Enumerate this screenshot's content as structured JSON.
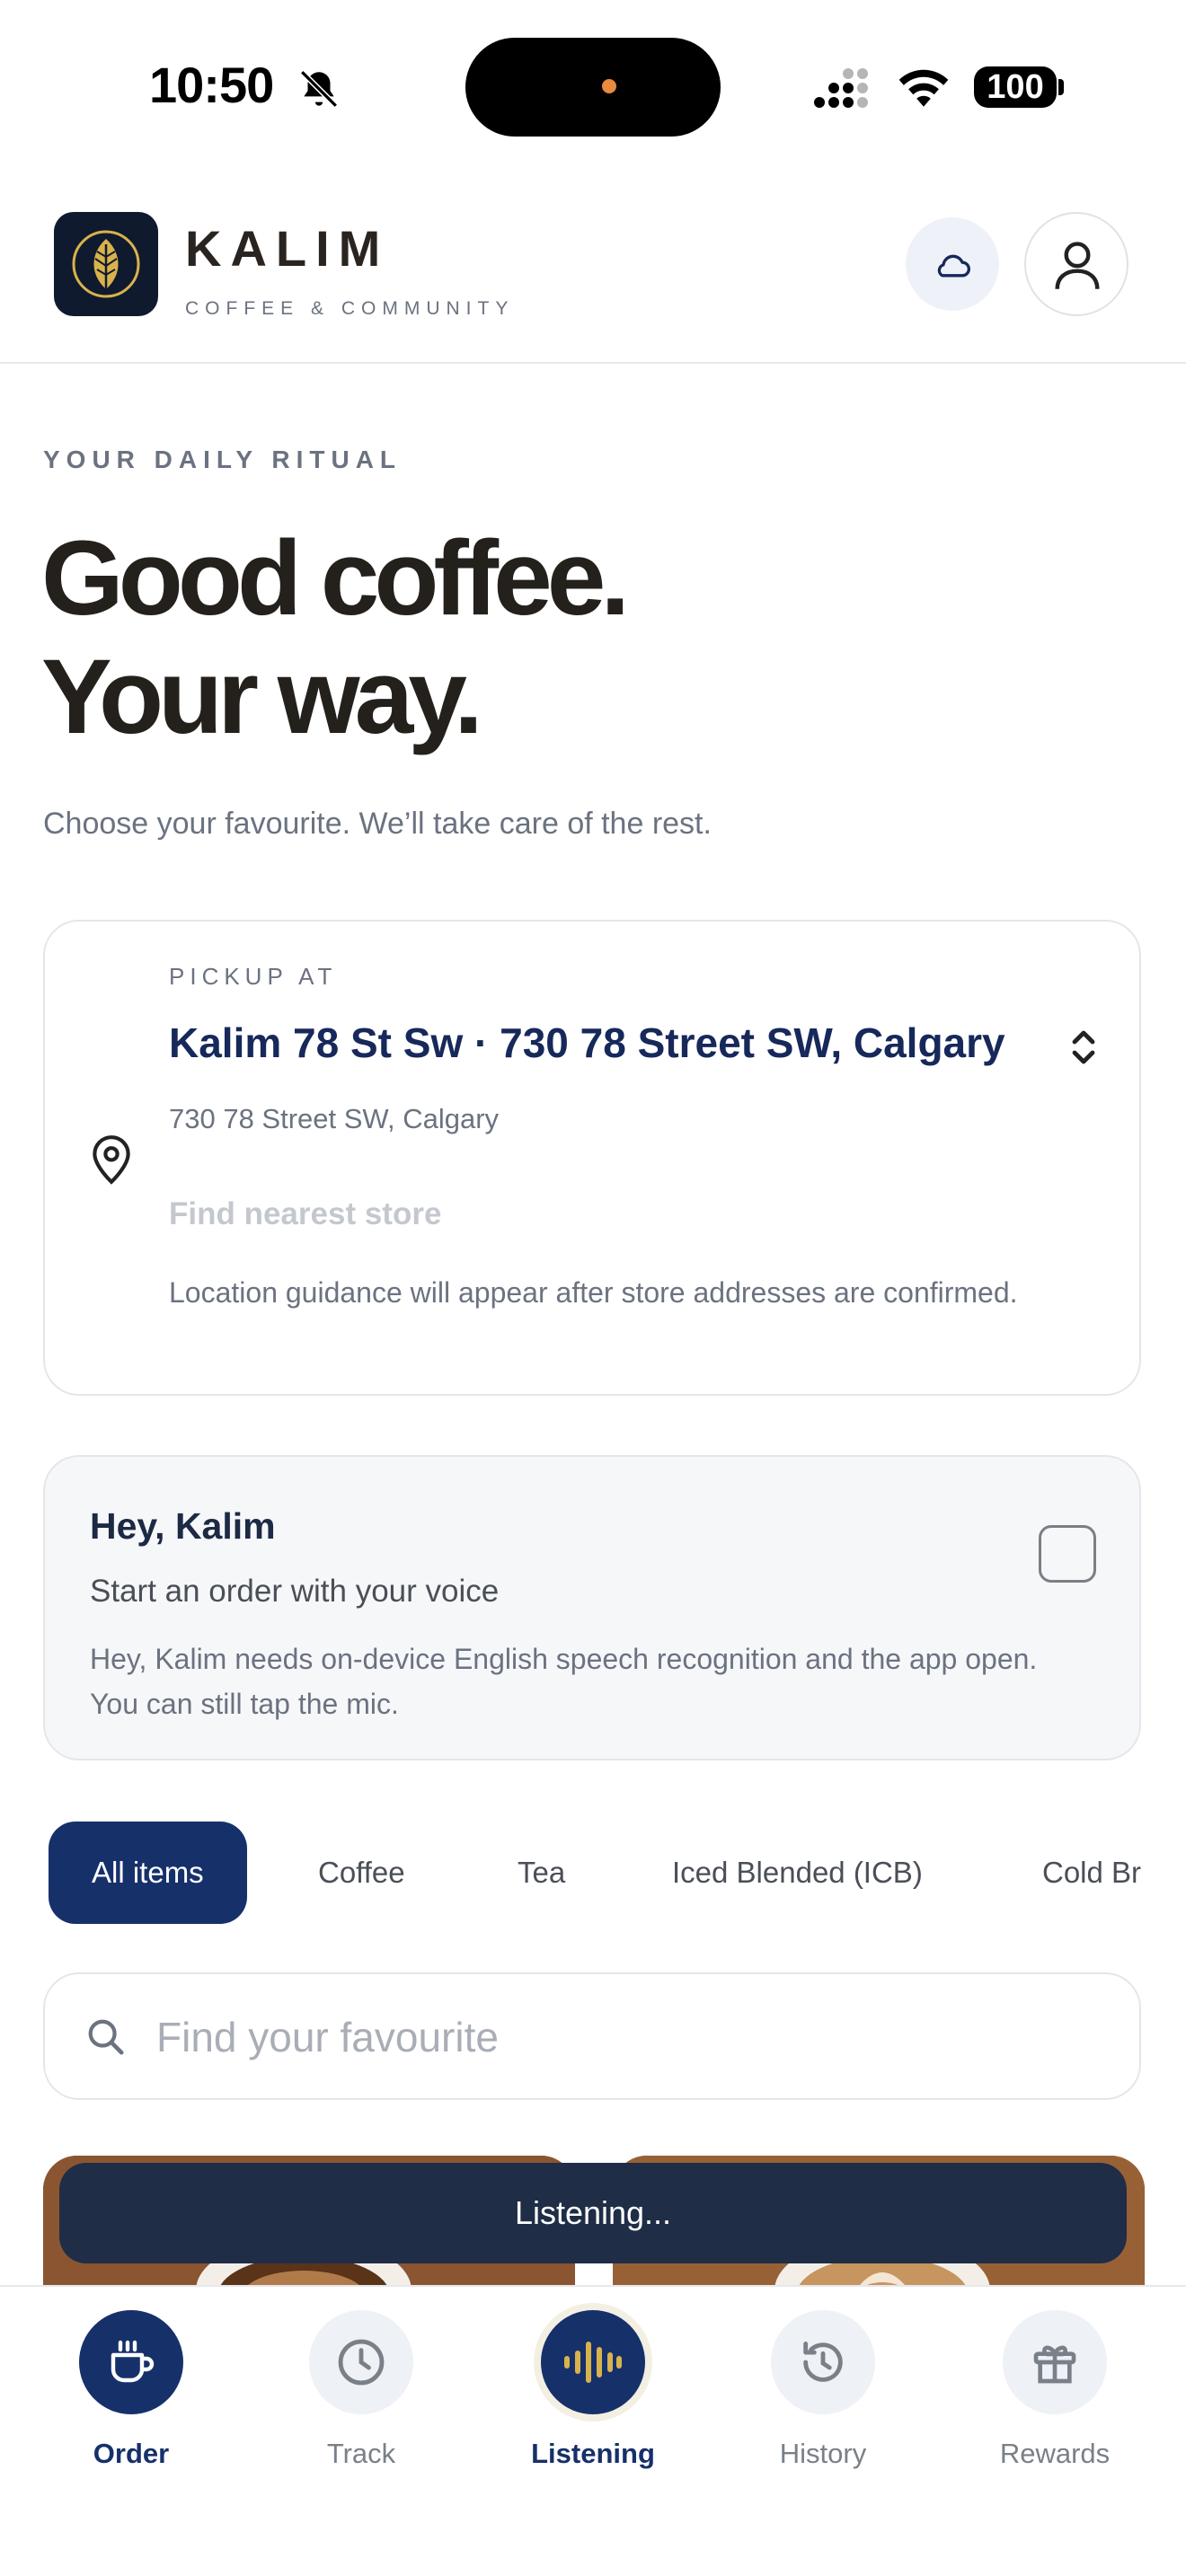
{
  "status_bar": {
    "time": "10:50",
    "battery": "100"
  },
  "header": {
    "brand": "KALIM",
    "brand_sub": "COFFEE & COMMUNITY",
    "logo_icon": "leaf-icon",
    "cloud_icon": "cloud-icon",
    "profile_icon": "user-icon"
  },
  "hero": {
    "eyebrow": "YOUR DAILY RITUAL",
    "title_line1": "Good coffee.",
    "title_line2": "Your way.",
    "subtitle": "Choose your favourite. We’ll take care of the rest."
  },
  "pickup": {
    "label": "PICKUP AT",
    "store_name": "Kalim 78 St Sw · 730 78 Street SW, Calgary",
    "address": "730 78 Street SW, Calgary",
    "find_nearest": "Find nearest store",
    "guidance": "Location guidance will appear after store addresses are confirmed."
  },
  "voice": {
    "title": "Hey, Kalim",
    "subtitle": "Start an order with your voice",
    "note": "Hey, Kalim needs on-device English speech recognition and the app open. You can still tap the mic."
  },
  "categories": [
    "All items",
    "Coffee",
    "Tea",
    "Iced Blended (ICB)",
    "Cold Br"
  ],
  "search": {
    "placeholder": "Find your favourite"
  },
  "toast": "Listening...",
  "nav": {
    "order": "Order",
    "track": "Track",
    "listening": "Listening",
    "history": "History",
    "rewards": "Rewards"
  },
  "colors": {
    "navy": "#16306a",
    "gold": "#d9b24c",
    "ink": "#24201c",
    "muted": "#6b7280"
  }
}
